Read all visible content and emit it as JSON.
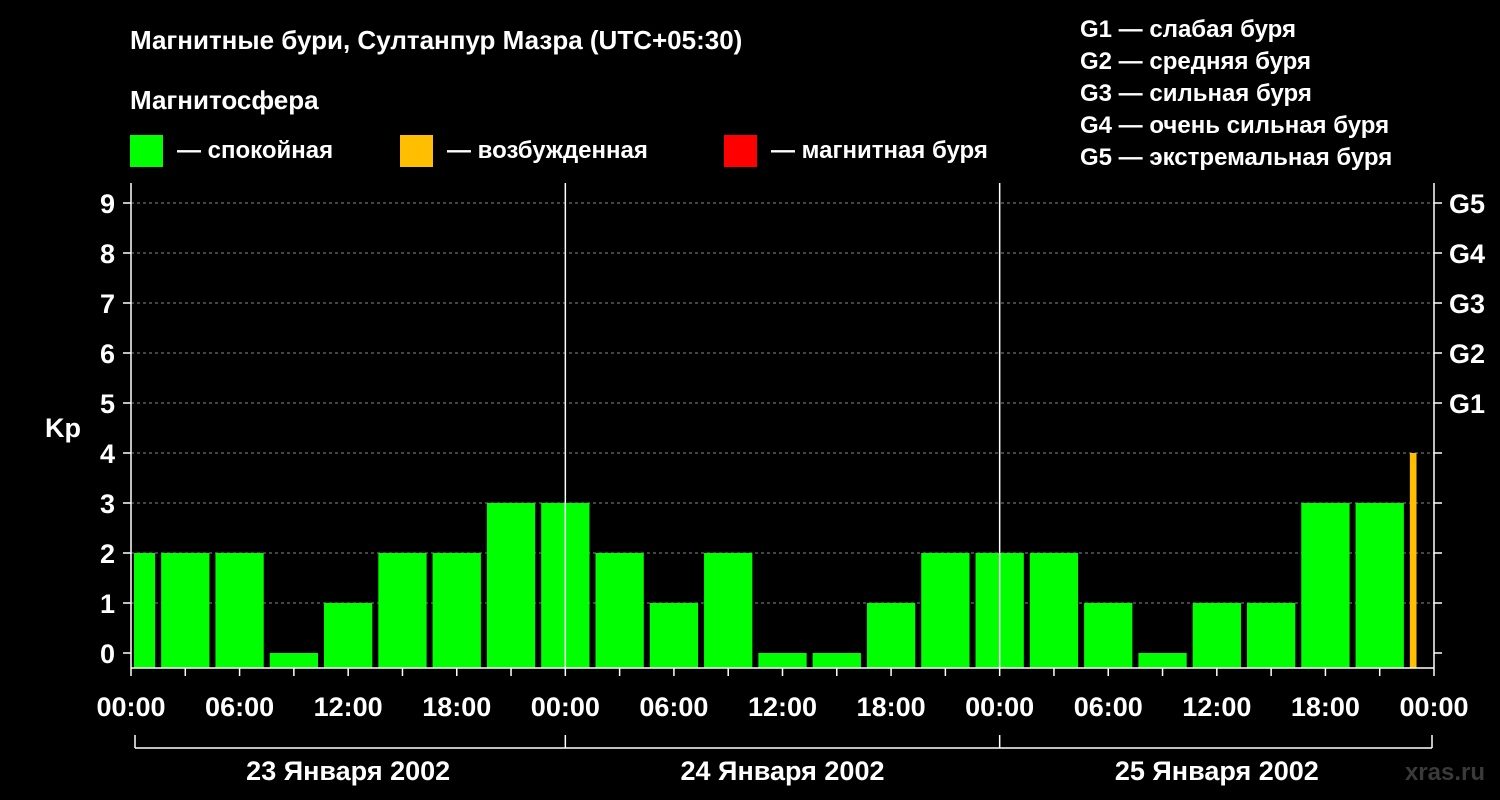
{
  "header": {
    "title": "Магнитные бури, Султанпур Мазра (UTC+05:30)",
    "legend_title": "Магнитосфера"
  },
  "legend": [
    {
      "label": "— спокойная",
      "color": "#00ff00"
    },
    {
      "label": "— возбужденная",
      "color": "#ffbf00"
    },
    {
      "label": "— магнитная буря",
      "color": "#ff0000"
    }
  ],
  "g_legend": [
    "G1 — слабая буря",
    "G2 — средняя буря",
    "G3 — сильная буря",
    "G4 — очень сильная буря",
    "G5 — экстремальная буря"
  ],
  "watermark": "xras.ru",
  "chart_data": {
    "type": "bar",
    "ylabel": "Kp",
    "ylim": [
      0,
      9
    ],
    "yticks": [
      0,
      1,
      2,
      3,
      4,
      5,
      6,
      7,
      8,
      9
    ],
    "right_ticks": [
      {
        "value": 5,
        "label": "G1"
      },
      {
        "value": 6,
        "label": "G2"
      },
      {
        "value": 7,
        "label": "G3"
      },
      {
        "value": 8,
        "label": "G4"
      },
      {
        "value": 9,
        "label": "G5"
      }
    ],
    "grid": true,
    "x_range_hours": [
      0,
      72
    ],
    "xtick_labels": [
      "00:00",
      "06:00",
      "12:00",
      "18:00",
      "00:00",
      "06:00",
      "12:00",
      "18:00",
      "00:00",
      "06:00",
      "12:00",
      "18:00",
      "00:00"
    ],
    "days": [
      "23 Января 2002",
      "24 Января 2002",
      "25 Января 2002"
    ],
    "bars": [
      {
        "start": 0,
        "end": 1.5,
        "kp": 2,
        "level": "quiet"
      },
      {
        "start": 1.5,
        "end": 4.5,
        "kp": 2,
        "level": "quiet"
      },
      {
        "start": 4.5,
        "end": 7.5,
        "kp": 2,
        "level": "quiet"
      },
      {
        "start": 7.5,
        "end": 10.5,
        "kp": 0,
        "level": "quiet"
      },
      {
        "start": 10.5,
        "end": 13.5,
        "kp": 1,
        "level": "quiet"
      },
      {
        "start": 13.5,
        "end": 16.5,
        "kp": 2,
        "level": "quiet"
      },
      {
        "start": 16.5,
        "end": 19.5,
        "kp": 2,
        "level": "quiet"
      },
      {
        "start": 19.5,
        "end": 22.5,
        "kp": 3,
        "level": "quiet"
      },
      {
        "start": 22.5,
        "end": 25.5,
        "kp": 3,
        "level": "quiet"
      },
      {
        "start": 25.5,
        "end": 28.5,
        "kp": 2,
        "level": "quiet"
      },
      {
        "start": 28.5,
        "end": 31.5,
        "kp": 1,
        "level": "quiet"
      },
      {
        "start": 31.5,
        "end": 34.5,
        "kp": 2,
        "level": "quiet"
      },
      {
        "start": 34.5,
        "end": 37.5,
        "kp": 0,
        "level": "quiet"
      },
      {
        "start": 37.5,
        "end": 40.5,
        "kp": 0,
        "level": "quiet"
      },
      {
        "start": 40.5,
        "end": 43.5,
        "kp": 1,
        "level": "quiet"
      },
      {
        "start": 43.5,
        "end": 46.5,
        "kp": 2,
        "level": "quiet"
      },
      {
        "start": 46.5,
        "end": 49.5,
        "kp": 2,
        "level": "quiet"
      },
      {
        "start": 49.5,
        "end": 52.5,
        "kp": 2,
        "level": "quiet"
      },
      {
        "start": 52.5,
        "end": 55.5,
        "kp": 1,
        "level": "quiet"
      },
      {
        "start": 55.5,
        "end": 58.5,
        "kp": 0,
        "level": "quiet"
      },
      {
        "start": 58.5,
        "end": 61.5,
        "kp": 1,
        "level": "quiet"
      },
      {
        "start": 61.5,
        "end": 64.5,
        "kp": 1,
        "level": "quiet"
      },
      {
        "start": 64.5,
        "end": 67.5,
        "kp": 3,
        "level": "quiet"
      },
      {
        "start": 67.5,
        "end": 70.5,
        "kp": 3,
        "level": "quiet"
      },
      {
        "start": 70.5,
        "end": 71.2,
        "kp": 4,
        "level": "active"
      }
    ]
  }
}
